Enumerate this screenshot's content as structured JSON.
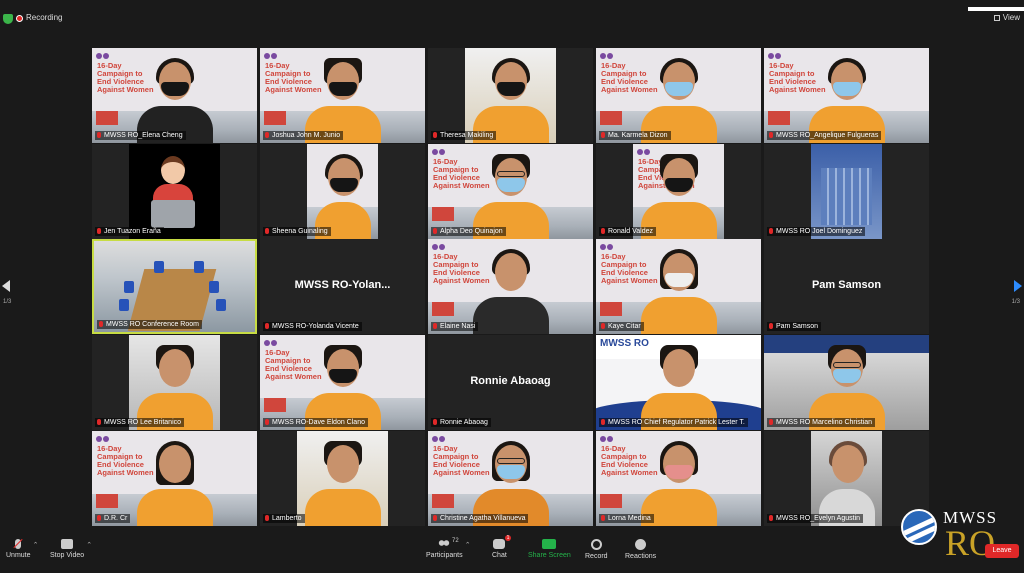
{
  "top": {
    "recording_label": "Recording",
    "view_label": "View"
  },
  "poster": {
    "title": "16-Day\nCampaign to\nEnd Violence\nAgainst Women"
  },
  "mwss_banner": "MWSS RO",
  "tiles": [
    {
      "name": "MWSS RO_Elena Cheng"
    },
    {
      "name": "Joshua John M. Junio"
    },
    {
      "name": "Theresa Makiling"
    },
    {
      "name": "Ma. Karmela Dizon"
    },
    {
      "name": "MWSS RO_Angelique Fulgueras"
    },
    {
      "name": "Jen Tuazon Eraña"
    },
    {
      "name": "Sheena Guinaling"
    },
    {
      "name": "Alpha Deo Quinajon"
    },
    {
      "name": "Ronald Valdez"
    },
    {
      "name": "MWSS RO Joel Dominguez"
    },
    {
      "name": "MWSS RO Conference Room"
    },
    {
      "name": "MWSS RO-Yolanda Vicente",
      "display_name": "MWSS  RO-Yolan..."
    },
    {
      "name": "Elaine Nasi"
    },
    {
      "name": "Kaye Citar"
    },
    {
      "name": "Pam Samson",
      "display_name": "Pam Samson"
    },
    {
      "name": "MWSS RO Lee Britanico"
    },
    {
      "name": "MWSS RO-Dave Eldon Clano"
    },
    {
      "name": "Ronnie Abaoag",
      "display_name": "Ronnie Abaoag"
    },
    {
      "name": "MWSS RO Chief Regulator Patrick Lester T."
    },
    {
      "name": "MWSS RO Marcelino Christian"
    },
    {
      "name": "D.R. Cr"
    },
    {
      "name": "Lamberto"
    },
    {
      "name": "Christine Agatha Villanueva"
    },
    {
      "name": "Lorna Medina"
    },
    {
      "name": "MWSS RO_Evelyn Agustin"
    }
  ],
  "pagination": {
    "left": "1/3",
    "right": "1/3"
  },
  "toolbar": {
    "unmute": "Unmute",
    "stop_video": "Stop Video",
    "participants": "Participants",
    "participant_count": "72",
    "chat": "Chat",
    "chat_badge": "1",
    "share_screen": "Share Screen",
    "record": "Record",
    "reactions": "Reactions",
    "leave": "Leave"
  },
  "watermark": {
    "line1": "MWSS",
    "line2": "RO"
  },
  "colors": {
    "share_green": "#24b24a",
    "leave_red": "#e02828",
    "active_border": "#c7dc44",
    "shirt_orange": "#f0a030"
  }
}
